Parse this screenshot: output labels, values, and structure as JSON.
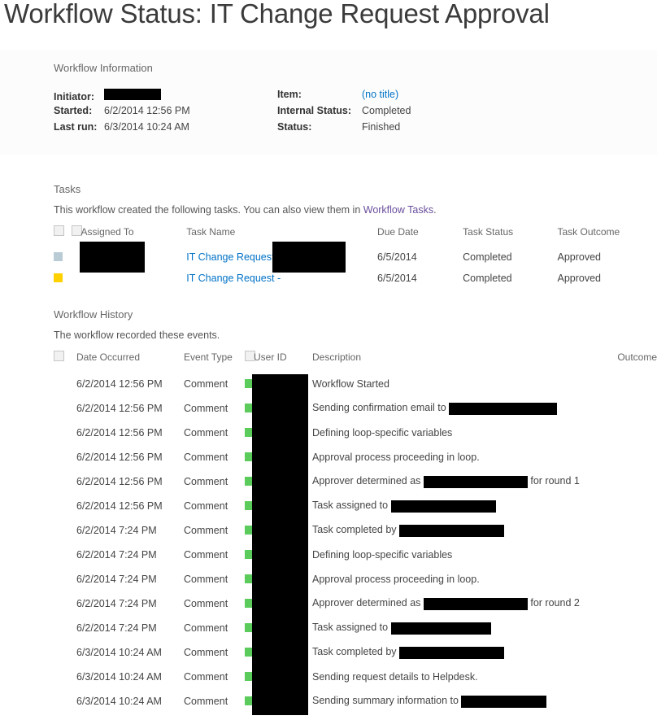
{
  "page": {
    "title": "Workflow Status: IT Change Request Approval"
  },
  "workflow_information": {
    "heading": "Workflow Information",
    "left": [
      {
        "label": "Initiator:",
        "value": "",
        "redacted": true,
        "redact_width": 70
      },
      {
        "label": "Started:",
        "value": "6/2/2014 12:56 PM",
        "redacted": false
      },
      {
        "label": "Last run:",
        "value": "6/3/2014 10:24 AM",
        "redacted": false
      }
    ],
    "right": [
      {
        "label": "Item:",
        "value": "(no title)",
        "is_link": true
      },
      {
        "label": "Internal Status:",
        "value": "Completed",
        "is_link": false
      },
      {
        "label": "Status:",
        "value": "Finished",
        "is_link": false
      }
    ]
  },
  "tasks": {
    "heading": "Tasks",
    "subtext_before": "This workflow created the following tasks. You can also view them in ",
    "subtext_link": "Workflow Tasks",
    "subtext_after": ".",
    "columns": [
      "Assigned To",
      "Task Name",
      "Due Date",
      "Task Status",
      "Task Outcome"
    ],
    "rows": [
      {
        "status_color": "#b9ccd6",
        "assigned_to": "",
        "task_name": "IT Change Request -",
        "due_date": "6/5/2014",
        "task_status": "Completed",
        "task_outcome": "Approved"
      },
      {
        "status_color": "#ffd100",
        "assigned_to": "",
        "task_name": "IT Change Request -",
        "due_date": "6/5/2014",
        "task_status": "Completed",
        "task_outcome": "Approved"
      }
    ]
  },
  "workflow_history": {
    "heading": "Workflow History",
    "subtext": "The workflow recorded these events.",
    "columns": [
      "Date Occurred",
      "Event Type",
      "User ID",
      "Description",
      "Outcome"
    ],
    "status_color": "#5bcc5b",
    "rows": [
      {
        "date": "6/2/2014 12:56 PM",
        "event_type": "Comment",
        "desc_before": "Workflow Started",
        "redact_width": 0,
        "desc_after": "",
        "outcome": ""
      },
      {
        "date": "6/2/2014 12:56 PM",
        "event_type": "Comment",
        "desc_before": "Sending confirmation email to ",
        "redact_width": 133,
        "desc_after": "",
        "outcome": ""
      },
      {
        "date": "6/2/2014 12:56 PM",
        "event_type": "Comment",
        "desc_before": "Defining loop-specific variables",
        "redact_width": 0,
        "desc_after": "",
        "outcome": ""
      },
      {
        "date": "6/2/2014 12:56 PM",
        "event_type": "Comment",
        "desc_before": "Approval process proceeding in loop.",
        "redact_width": 0,
        "desc_after": "",
        "outcome": ""
      },
      {
        "date": "6/2/2014 12:56 PM",
        "event_type": "Comment",
        "desc_before": "Approver determined as ",
        "redact_width": 128,
        "desc_after": " for round 1",
        "outcome": ""
      },
      {
        "date": "6/2/2014 12:56 PM",
        "event_type": "Comment",
        "desc_before": "Task assigned to ",
        "redact_width": 129,
        "desc_after": "",
        "outcome": ""
      },
      {
        "date": "6/2/2014 7:24 PM",
        "event_type": "Comment",
        "desc_before": "Task completed by ",
        "redact_width": 129,
        "desc_after": "",
        "outcome": ""
      },
      {
        "date": "6/2/2014 7:24 PM",
        "event_type": "Comment",
        "desc_before": "Defining loop-specific variables",
        "redact_width": 0,
        "desc_after": "",
        "outcome": ""
      },
      {
        "date": "6/2/2014 7:24 PM",
        "event_type": "Comment",
        "desc_before": "Approval process proceeding in loop.",
        "redact_width": 0,
        "desc_after": "",
        "outcome": ""
      },
      {
        "date": "6/2/2014 7:24 PM",
        "event_type": "Comment",
        "desc_before": "Approver determined as ",
        "redact_width": 128,
        "desc_after": " for round 2",
        "outcome": ""
      },
      {
        "date": "6/2/2014 7:24 PM",
        "event_type": "Comment",
        "desc_before": "Task assigned to ",
        "redact_width": 123,
        "desc_after": "",
        "outcome": ""
      },
      {
        "date": "6/3/2014 10:24 AM",
        "event_type": "Comment",
        "desc_before": "Task completed by ",
        "redact_width": 129,
        "desc_after": "",
        "outcome": ""
      },
      {
        "date": "6/3/2014 10:24 AM",
        "event_type": "Comment",
        "desc_before": "Sending request details to Helpdesk.",
        "redact_width": 0,
        "desc_after": "",
        "outcome": ""
      },
      {
        "date": "6/3/2014 10:24 AM",
        "event_type": "Comment",
        "desc_before": "Sending summary information to ",
        "redact_width": 105,
        "desc_after": "",
        "outcome": ""
      }
    ]
  }
}
